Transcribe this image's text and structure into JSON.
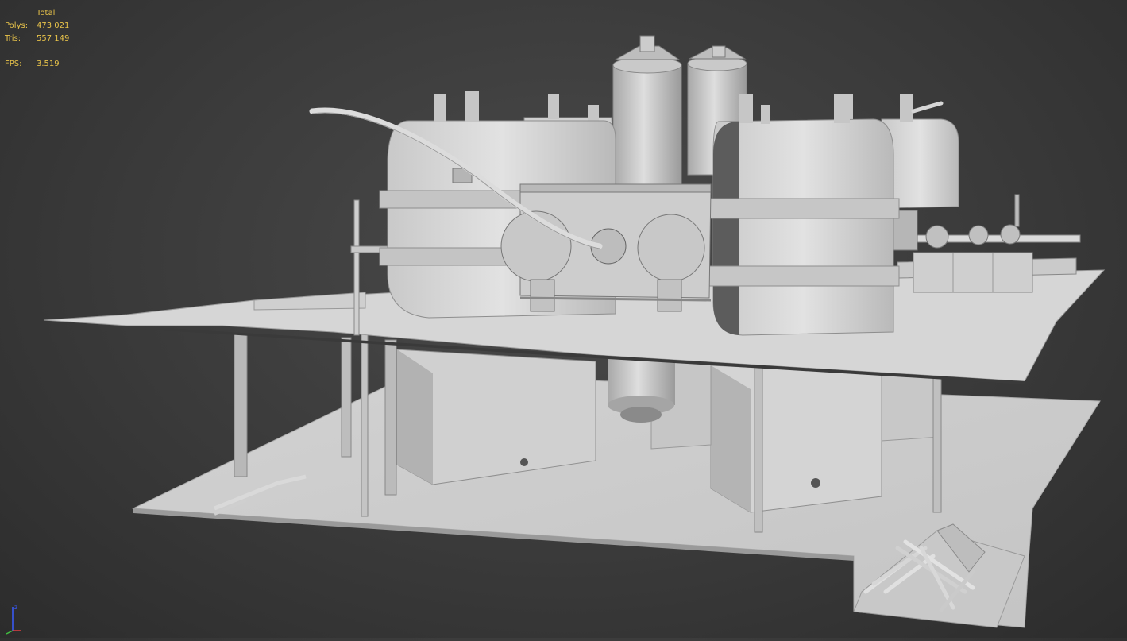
{
  "stats": {
    "header": "Total",
    "polys_label": "Polys:",
    "polys_value": "473 021",
    "tris_label": "Tris:",
    "tris_value": "557 149",
    "fps_label": "FPS:",
    "fps_value": "3.519"
  },
  "gizmo": {
    "z_label": "z"
  },
  "colors": {
    "background": "#3a3a3a",
    "stats_text": "#e8c34a",
    "model_light": "#d6d6d6",
    "model_mid": "#bcbcbc",
    "model_dark": "#8a8a8a"
  }
}
